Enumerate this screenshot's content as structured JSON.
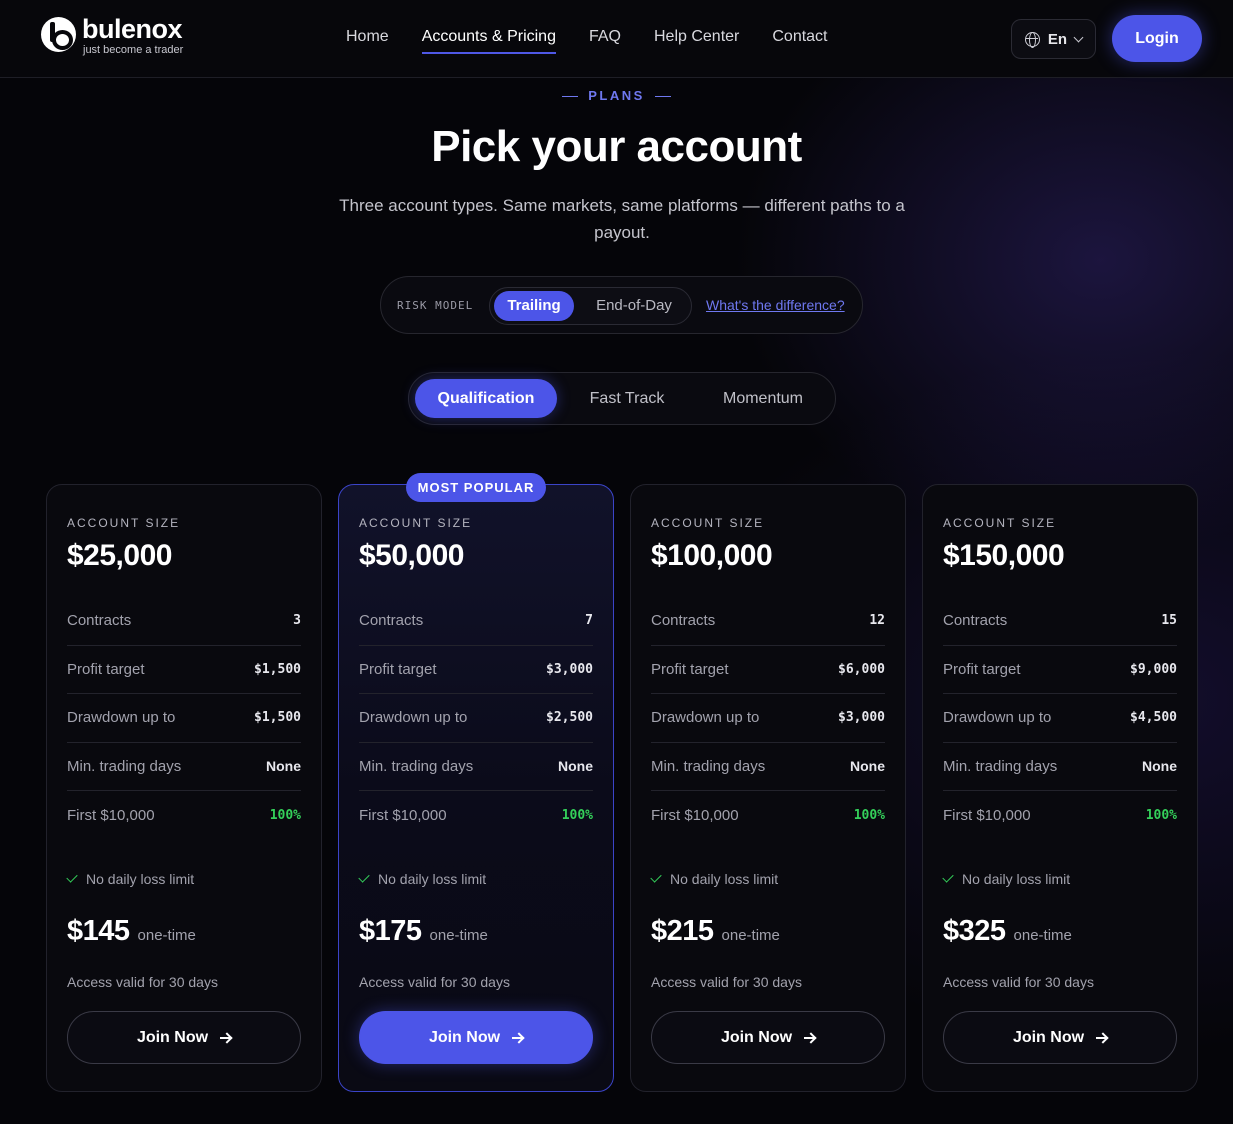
{
  "brand": {
    "name": "bulenox",
    "tagline": "just become a trader"
  },
  "nav": {
    "items": [
      {
        "label": "Home"
      },
      {
        "label": "Accounts & Pricing",
        "active": true
      },
      {
        "label": "FAQ"
      },
      {
        "label": "Help Center"
      },
      {
        "label": "Contact"
      }
    ],
    "language": "En",
    "login_label": "Login"
  },
  "hero": {
    "eyebrow": "PLANS",
    "title": "Pick your account",
    "subtitle": "Three account types. Same markets, same platforms — different paths to a payout."
  },
  "risk_model": {
    "label": "RISK MODEL",
    "options": [
      "Trailing",
      "End-of-Day"
    ],
    "selected": "Trailing",
    "link": "What's the difference?"
  },
  "account_types": {
    "options": [
      "Qualification",
      "Fast Track",
      "Momentum"
    ],
    "selected": "Qualification"
  },
  "colors": {
    "accent": "#4c55e8",
    "green": "#34d05a",
    "background": "#050509"
  },
  "cards": [
    {
      "label": "ACCOUNT SIZE",
      "size": "$25,000",
      "rows": [
        {
          "k": "Contracts",
          "v": "3"
        },
        {
          "k": "Profit target",
          "v": "$1,500"
        },
        {
          "k": "Drawdown up to",
          "v": "$1,500"
        },
        {
          "k": "Min. trading days",
          "v": "None"
        },
        {
          "k": "First $10,000",
          "v": "100%"
        }
      ],
      "feature": "No daily loss limit",
      "price": "$145",
      "price_note": "one-time",
      "access": "Access valid for 30 days",
      "cta": "Join Now"
    },
    {
      "badge": "MOST POPULAR",
      "label": "ACCOUNT SIZE",
      "size": "$50,000",
      "rows": [
        {
          "k": "Contracts",
          "v": "7"
        },
        {
          "k": "Profit target",
          "v": "$3,000"
        },
        {
          "k": "Drawdown up to",
          "v": "$2,500"
        },
        {
          "k": "Min. trading days",
          "v": "None"
        },
        {
          "k": "First $10,000",
          "v": "100%"
        }
      ],
      "feature": "No daily loss limit",
      "price": "$175",
      "price_note": "one-time",
      "access": "Access valid for 30 days",
      "cta": "Join Now"
    },
    {
      "label": "ACCOUNT SIZE",
      "size": "$100,000",
      "rows": [
        {
          "k": "Contracts",
          "v": "12"
        },
        {
          "k": "Profit target",
          "v": "$6,000"
        },
        {
          "k": "Drawdown up to",
          "v": "$3,000"
        },
        {
          "k": "Min. trading days",
          "v": "None"
        },
        {
          "k": "First $10,000",
          "v": "100%"
        }
      ],
      "feature": "No daily loss limit",
      "price": "$215",
      "price_note": "one-time",
      "access": "Access valid for 30 days",
      "cta": "Join Now"
    },
    {
      "label": "ACCOUNT SIZE",
      "size": "$150,000",
      "rows": [
        {
          "k": "Contracts",
          "v": "15"
        },
        {
          "k": "Profit target",
          "v": "$9,000"
        },
        {
          "k": "Drawdown up to",
          "v": "$4,500"
        },
        {
          "k": "Min. trading days",
          "v": "None"
        },
        {
          "k": "First $10,000",
          "v": "100%"
        }
      ],
      "feature": "No daily loss limit",
      "price": "$325",
      "price_note": "one-time",
      "access": "Access valid for 30 days",
      "cta": "Join Now"
    }
  ]
}
